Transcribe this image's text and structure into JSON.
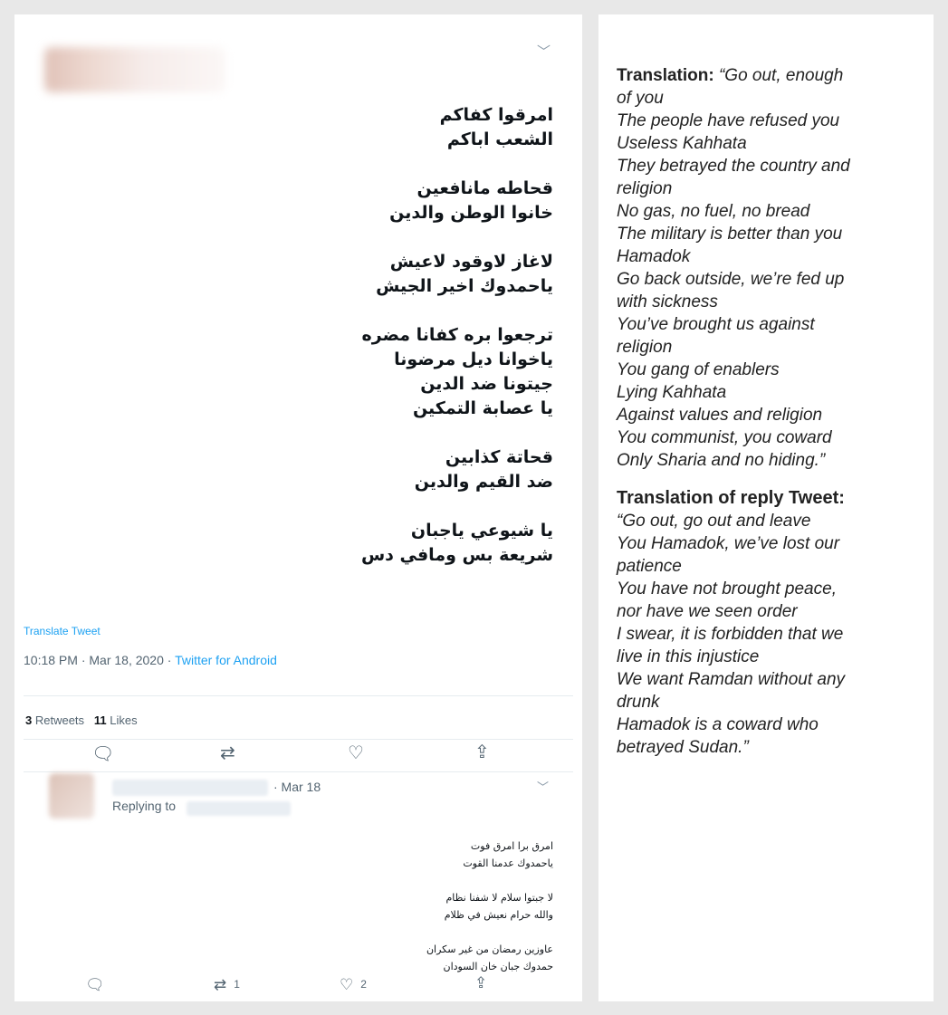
{
  "tweet": {
    "arabic_lines": [
      "امرقوا كفاكم",
      "الشعب اباكم",
      "",
      "قحاطه مانافعين",
      "خانوا الوطن والدين",
      "",
      "لاغاز  لاوقود  لاعيش",
      "ياحمدوك اخير الجيش",
      "",
      "ترجعوا بره كفانا مضره",
      "ياخوانا ديل مرضونا",
      "جيتونا ضد الدين",
      "يا عصابة التمكين",
      "",
      "قحاتة كذابين",
      "ضد القيم والدين",
      "",
      "يا  شيوعي ياجبان",
      "شريعة بس ومافي دس"
    ],
    "translate_label": "Translate Tweet",
    "timestamp": "10:18 PM · Mar 18, 2020 · ",
    "source": "Twitter for Android",
    "retweets_count": "3",
    "retweets_label": " Retweets",
    "likes_count": "11",
    "likes_label": " Likes"
  },
  "reply": {
    "date": "· Mar 18",
    "replying_to": "Replying to",
    "arabic_lines": [
      "امرق برا امرق فوت",
      "ياحمدوك عدمنا القوت",
      "",
      "لا جبتوا سلام لا شفنا نظام",
      "والله حرام نعيش في ظلام",
      "",
      "عاوزين رمضان من غير سكران",
      "حمدوك جبان خان السودان"
    ],
    "retweet_count": "1",
    "like_count": "2"
  },
  "icons": {
    "chevron": "chevron-down-icon",
    "reply": "reply-icon",
    "retweet": "retweet-icon",
    "like": "heart-icon",
    "share": "share-icon"
  },
  "translation": {
    "heading": "Translation:",
    "first_line": " “Go out, enough",
    "lines": [
      "of you",
      "The people have refused you",
      "Useless Kahhata",
      "They betrayed the country and",
      "religion",
      "No gas, no fuel, no bread",
      "The military is better than you",
      "Hamadok",
      "Go back outside, we’re fed up",
      "with sickness",
      "You’ve brought us against",
      "religion",
      "You gang of enablers",
      "Lying Kahhata",
      "Against values and religion",
      "You communist, you coward",
      "Only Sharia and no hiding.”"
    ],
    "reply_heading": "Translation of reply Tweet:",
    "reply_lines": [
      "“Go out, go out and leave",
      "You Hamadok, we’ve lost our",
      "patience",
      "You have not brought peace,",
      "nor have we seen order",
      "I swear, it is forbidden that we",
      "live in this injustice",
      "We want Ramdan without any",
      "drunk",
      "Hamadok is a coward who",
      "betrayed Sudan.”"
    ]
  },
  "colors": {
    "link": "#1da1f2",
    "muted": "#536471",
    "background": "#e8e8e8"
  }
}
